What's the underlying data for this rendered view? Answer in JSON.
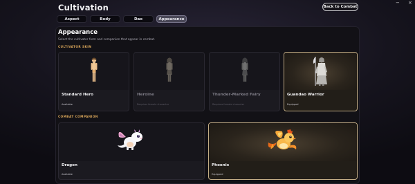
{
  "window": {
    "title": "Cultivation",
    "back_label": "Back to Combat",
    "minimize": "−",
    "close": "×"
  },
  "tabs": [
    {
      "label": "Aspect"
    },
    {
      "label": "Body"
    },
    {
      "label": "Dao"
    },
    {
      "label": "Appearance",
      "active": true
    }
  ],
  "panel": {
    "title": "Appearance",
    "subtitle": "Select the cultivator form and companion that appear in combat.",
    "skin_section": "CULTIVATOR SKIN",
    "companion_section": "COMBAT COMPANION"
  },
  "skins": [
    {
      "name": "Standard Hero",
      "status": "Available"
    },
    {
      "name": "Heroine",
      "status": "Requires female character"
    },
    {
      "name": "Thunder-Marked Fairy",
      "status": "Requires female character"
    },
    {
      "name": "Guandao Warrior",
      "status": "Equipped"
    }
  ],
  "companions": [
    {
      "name": "Dragon",
      "status": "Available"
    },
    {
      "name": "Phoenix",
      "status": "Equipped"
    }
  ],
  "colors": {
    "accent_gold": "#d9a65a",
    "equipped_border": "#c3ad86",
    "background": "#121116"
  },
  "icons": [
    "standard-hero-figure",
    "heroine-figure",
    "thunder-fairy-figure",
    "guandao-warrior-figure",
    "dragon-companion",
    "phoenix-companion"
  ]
}
